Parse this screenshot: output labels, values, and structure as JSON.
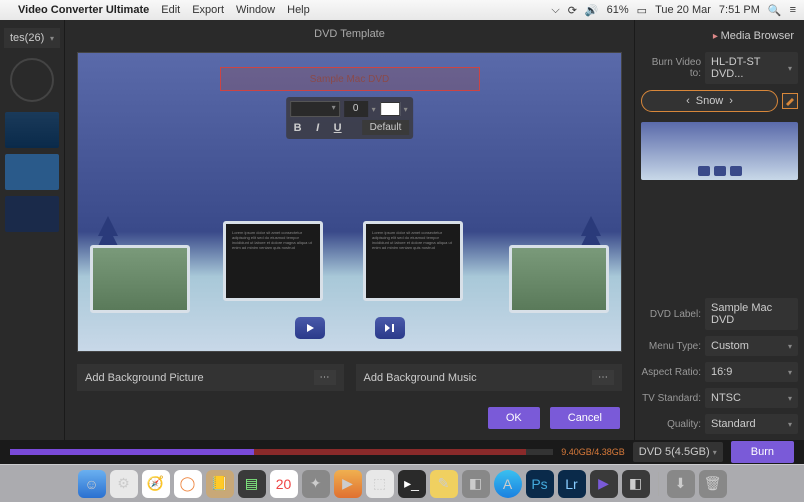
{
  "menubar": {
    "app": "Video Converter Ultimate",
    "items": [
      "Edit",
      "Export",
      "Window",
      "Help"
    ],
    "battery": "61%",
    "date": "Tue 20 Mar",
    "time": "7:51 PM"
  },
  "sidebar": {
    "templates_label": "tes(26)"
  },
  "dialog": {
    "title": "DVD Template",
    "dvd_title": "Sample Mac DVD",
    "font_size": "0",
    "default_btn": "Default",
    "bg_picture": "Add Background Picture",
    "bg_music": "Add Background Music",
    "ok": "OK",
    "cancel": "Cancel"
  },
  "right": {
    "media_browser": "Media Browser",
    "burn_to_label": "Burn Video to:",
    "burn_to_value": "HL-DT-ST DVD...",
    "template": "Snow",
    "dvd_label_l": "DVD Label:",
    "dvd_label_v": "Sample Mac DVD",
    "menu_type_l": "Menu Type:",
    "menu_type_v": "Custom",
    "aspect_l": "Aspect Ratio:",
    "aspect_v": "16:9",
    "tv_l": "TV Standard:",
    "tv_v": "NTSC",
    "quality_l": "Quality:",
    "quality_v": "Standard"
  },
  "bar": {
    "size": "9.40GB/4.38GB",
    "disc": "DVD 5(4.5GB)",
    "burn": "Burn"
  }
}
